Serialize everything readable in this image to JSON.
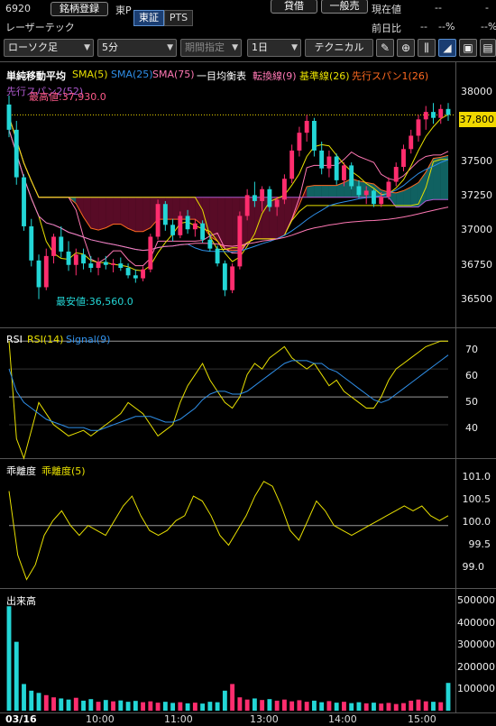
{
  "header": {
    "code": "6920",
    "register_button": "銘柄登録",
    "market": "東P",
    "borrow_button": "貸借",
    "general_sell_button": "一般売",
    "current_price_label": "現在値",
    "current_price_value": "--",
    "current_price_dash2": "-",
    "name": "レーザーテック",
    "exchange_tabs": [
      "東証",
      "PTS"
    ],
    "prev_change_label": "前日比",
    "prev_change_value": "--",
    "prev_change_pct": "--%",
    "pct_right": "--%"
  },
  "toolbar": {
    "chart_type": "ローソク足",
    "interval": "5分",
    "period": "期間指定",
    "range": "1日",
    "technical": "テクニカル"
  },
  "legend": {
    "sma_title": "単純移動平均",
    "sma5": "SMA(5)",
    "sma25": "SMA(25)",
    "sma75": "SMA(75)",
    "ichimoku_title": "一目均衡表",
    "tenkan": "転換線(9)",
    "kijun": "基準線(26)",
    "senkou1": "先行スパン1(26)",
    "senkou2": "先行スパン2(52)",
    "high_annotation": "最高値:37,930.0",
    "low_annotation": "最安値:36,560.0",
    "last_price": "37,800"
  },
  "colors": {
    "up": "#ff2d6e",
    "down": "#23d6d6",
    "sma5": "#e8e000",
    "sma25": "#2f8fe8",
    "sma75": "#ff78b4",
    "tenkan": "#ff78b4",
    "kijun": "#e8e000",
    "senkou1": "#ff6a20",
    "senkou2": "#b05ad0"
  },
  "price_axis": [
    "38000",
    "37750",
    "37500",
    "37250",
    "37000",
    "36750",
    "36500"
  ],
  "rsi_panel": {
    "title": "RSI",
    "rsi_label": "RSI(14)",
    "signal_label": "Signal(9)",
    "axis": [
      "70",
      "60",
      "50",
      "40"
    ]
  },
  "deviation_panel": {
    "title": "乖離度",
    "label": "乖離度(5)",
    "axis": [
      "101.0",
      "100.5",
      "100.0",
      "99.5",
      "99.0"
    ]
  },
  "volume_panel": {
    "title": "出来高",
    "axis": [
      "500000",
      "400000",
      "300000",
      "200000",
      "100000"
    ]
  },
  "time_axis": [
    "03/16",
    "10:00",
    "11:00",
    "13:00",
    "14:00",
    "15:00"
  ],
  "chart_data": {
    "type": "candlestick",
    "interval": "5分",
    "date": "03/16",
    "price_ylim": [
      36400,
      38100
    ],
    "high": 37930,
    "low": 36560,
    "last": 37800,
    "candles": [
      {
        "o": 37870,
        "h": 37930,
        "l": 37650,
        "c": 37700
      },
      {
        "o": 37700,
        "h": 37760,
        "l": 37330,
        "c": 37380
      },
      {
        "o": 37380,
        "h": 37400,
        "l": 37020,
        "c": 37050
      },
      {
        "o": 37050,
        "h": 37100,
        "l": 36780,
        "c": 36820
      },
      {
        "o": 36820,
        "h": 36860,
        "l": 36560,
        "c": 36640
      },
      {
        "o": 36640,
        "h": 36900,
        "l": 36620,
        "c": 36850
      },
      {
        "o": 36850,
        "h": 37000,
        "l": 36800,
        "c": 36980
      },
      {
        "o": 36980,
        "h": 37050,
        "l": 36840,
        "c": 36880
      },
      {
        "o": 36880,
        "h": 36950,
        "l": 36750,
        "c": 36790
      },
      {
        "o": 36790,
        "h": 36900,
        "l": 36720,
        "c": 36860
      },
      {
        "o": 36860,
        "h": 36900,
        "l": 36760,
        "c": 36800
      },
      {
        "o": 36800,
        "h": 36850,
        "l": 36740,
        "c": 36770
      },
      {
        "o": 36770,
        "h": 36840,
        "l": 36720,
        "c": 36810
      },
      {
        "o": 36810,
        "h": 36850,
        "l": 36760,
        "c": 36790
      },
      {
        "o": 36790,
        "h": 36830,
        "l": 36740,
        "c": 36800
      },
      {
        "o": 36800,
        "h": 36840,
        "l": 36750,
        "c": 36770
      },
      {
        "o": 36770,
        "h": 36800,
        "l": 36700,
        "c": 36720
      },
      {
        "o": 36720,
        "h": 36760,
        "l": 36670,
        "c": 36700
      },
      {
        "o": 36700,
        "h": 36780,
        "l": 36680,
        "c": 36760
      },
      {
        "o": 36760,
        "h": 37000,
        "l": 36740,
        "c": 36980
      },
      {
        "o": 36980,
        "h": 37230,
        "l": 36960,
        "c": 37200
      },
      {
        "o": 37200,
        "h": 37220,
        "l": 37020,
        "c": 37060
      },
      {
        "o": 37060,
        "h": 37100,
        "l": 36950,
        "c": 36990
      },
      {
        "o": 36990,
        "h": 37150,
        "l": 36970,
        "c": 37120
      },
      {
        "o": 37120,
        "h": 37160,
        "l": 37000,
        "c": 37030
      },
      {
        "o": 37030,
        "h": 37100,
        "l": 36980,
        "c": 37070
      },
      {
        "o": 37070,
        "h": 37090,
        "l": 36940,
        "c": 36960
      },
      {
        "o": 36960,
        "h": 37000,
        "l": 36880,
        "c": 36900
      },
      {
        "o": 36900,
        "h": 36920,
        "l": 36780,
        "c": 36800
      },
      {
        "o": 36800,
        "h": 36820,
        "l": 36580,
        "c": 36620
      },
      {
        "o": 36620,
        "h": 36800,
        "l": 36600,
        "c": 36780
      },
      {
        "o": 36780,
        "h": 37150,
        "l": 36760,
        "c": 37120
      },
      {
        "o": 37120,
        "h": 37300,
        "l": 37090,
        "c": 37260
      },
      {
        "o": 37260,
        "h": 37350,
        "l": 37180,
        "c": 37220
      },
      {
        "o": 37220,
        "h": 37320,
        "l": 37150,
        "c": 37300
      },
      {
        "o": 37300,
        "h": 37320,
        "l": 37150,
        "c": 37180
      },
      {
        "o": 37180,
        "h": 37250,
        "l": 37120,
        "c": 37230
      },
      {
        "o": 37230,
        "h": 37400,
        "l": 37200,
        "c": 37370
      },
      {
        "o": 37370,
        "h": 37600,
        "l": 37340,
        "c": 37560
      },
      {
        "o": 37560,
        "h": 37720,
        "l": 37520,
        "c": 37680
      },
      {
        "o": 37680,
        "h": 37800,
        "l": 37620,
        "c": 37760
      },
      {
        "o": 37760,
        "h": 37780,
        "l": 37520,
        "c": 37560
      },
      {
        "o": 37560,
        "h": 37620,
        "l": 37400,
        "c": 37440
      },
      {
        "o": 37440,
        "h": 37560,
        "l": 37380,
        "c": 37520
      },
      {
        "o": 37520,
        "h": 37540,
        "l": 37330,
        "c": 37360
      },
      {
        "o": 37360,
        "h": 37480,
        "l": 37320,
        "c": 37460
      },
      {
        "o": 37460,
        "h": 37480,
        "l": 37300,
        "c": 37320
      },
      {
        "o": 37320,
        "h": 37360,
        "l": 37240,
        "c": 37260
      },
      {
        "o": 37260,
        "h": 37320,
        "l": 37200,
        "c": 37290
      },
      {
        "o": 37290,
        "h": 37300,
        "l": 37180,
        "c": 37200
      },
      {
        "o": 37200,
        "h": 37280,
        "l": 37180,
        "c": 37250
      },
      {
        "o": 37250,
        "h": 37380,
        "l": 37230,
        "c": 37350
      },
      {
        "o": 37350,
        "h": 37480,
        "l": 37320,
        "c": 37450
      },
      {
        "o": 37450,
        "h": 37600,
        "l": 37420,
        "c": 37570
      },
      {
        "o": 37570,
        "h": 37700,
        "l": 37540,
        "c": 37660
      },
      {
        "o": 37660,
        "h": 37800,
        "l": 37620,
        "c": 37770
      },
      {
        "o": 37770,
        "h": 37860,
        "l": 37700,
        "c": 37820
      },
      {
        "o": 37820,
        "h": 37880,
        "l": 37740,
        "c": 37780
      },
      {
        "o": 37780,
        "h": 37870,
        "l": 37740,
        "c": 37840
      },
      {
        "o": 37840,
        "h": 37880,
        "l": 37760,
        "c": 37800
      }
    ],
    "rsi": [
      70,
      35,
      28,
      38,
      48,
      44,
      40,
      38,
      36,
      37,
      38,
      36,
      38,
      40,
      42,
      44,
      48,
      46,
      44,
      40,
      36,
      38,
      40,
      48,
      54,
      58,
      62,
      56,
      52,
      48,
      46,
      50,
      58,
      62,
      60,
      64,
      66,
      68,
      64,
      62,
      60,
      62,
      58,
      54,
      56,
      52,
      50,
      48,
      46,
      46,
      50,
      56,
      60,
      62,
      64,
      66,
      68,
      69,
      70,
      70
    ],
    "signal": [
      60,
      52,
      48,
      46,
      44,
      42,
      41,
      40,
      39,
      39,
      39,
      38,
      38,
      39,
      40,
      41,
      42,
      43,
      43,
      43,
      42,
      41,
      41,
      42,
      44,
      46,
      49,
      51,
      52,
      52,
      51,
      51,
      52,
      54,
      56,
      58,
      60,
      62,
      63,
      63,
      63,
      62,
      62,
      60,
      59,
      57,
      55,
      53,
      51,
      49,
      48,
      49,
      51,
      53,
      55,
      57,
      59,
      61,
      63,
      65
    ],
    "rsi_ylim": [
      30,
      72
    ],
    "deviation": [
      100.7,
      99.4,
      98.9,
      99.2,
      99.8,
      100.1,
      100.3,
      100.0,
      99.8,
      100.0,
      99.9,
      99.8,
      100.1,
      100.4,
      100.6,
      100.2,
      99.9,
      99.8,
      99.9,
      100.1,
      100.2,
      100.6,
      100.5,
      100.2,
      99.8,
      99.6,
      99.9,
      100.2,
      100.6,
      100.9,
      100.8,
      100.4,
      99.9,
      99.7,
      100.1,
      100.5,
      100.3,
      100.0,
      99.9,
      99.8,
      99.9,
      100.0,
      100.1,
      100.2,
      100.3,
      100.4,
      100.3,
      100.4,
      100.2,
      100.1,
      100.2
    ],
    "deviation_ylim": [
      98.8,
      101.3
    ],
    "volume": [
      470000,
      310000,
      120000,
      90000,
      80000,
      70000,
      60000,
      55000,
      50000,
      58000,
      45000,
      52000,
      40000,
      48000,
      42000,
      46000,
      40000,
      44000,
      38000,
      42000,
      36000,
      40000,
      35000,
      38000,
      33000,
      36000,
      32000,
      40000,
      38000,
      90000,
      120000,
      60000,
      50000,
      55000,
      48000,
      52000,
      45000,
      50000,
      42000,
      47000,
      40000,
      45000,
      38000,
      43000,
      36000,
      40000,
      34000,
      38000,
      33000,
      36000,
      32000,
      35000,
      30000,
      34000,
      45000,
      50000,
      42000,
      40000,
      38000,
      125000
    ],
    "volume_ylim": [
      0,
      540000
    ]
  }
}
